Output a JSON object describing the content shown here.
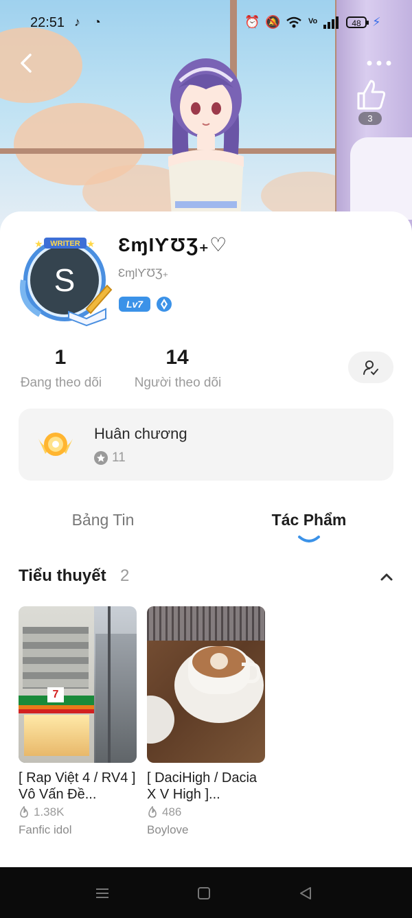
{
  "status_bar": {
    "time": "22:51",
    "battery": "48"
  },
  "header": {
    "like_count": "3"
  },
  "profile": {
    "avatar_letter": "S",
    "avatar_badge": "WRITER",
    "name": "ƐɱƖƳƱƷ₊♡",
    "handle": "ƐɱƖƳƱƷ₊",
    "level": "Lv7"
  },
  "stats": {
    "following_count": "1",
    "following_label": "Đang theo dõi",
    "followers_count": "14",
    "followers_label": "Người theo dõi"
  },
  "medals": {
    "title": "Huân chương",
    "count": "11"
  },
  "tabs": [
    {
      "label": "Bảng Tin",
      "active": false
    },
    {
      "label": "Tác Phẩm",
      "active": true
    }
  ],
  "section": {
    "title": "Tiểu thuyết",
    "count": "2"
  },
  "books": [
    {
      "title": "[ Rap Việt 4 / RV4 ] Vô Vấn Đề...",
      "views": "1.38K",
      "genre": "Fanfic  idol",
      "cover": "store-street-photo"
    },
    {
      "title": "[ DaciHigh / Dacia X V High ]...",
      "views": "486",
      "genre": "Boylove",
      "cover": "coffee-cup-photo"
    }
  ],
  "colors": {
    "accent": "#3b92e8",
    "indicator": "#3b92e8",
    "card_bg": "#f4f4f4"
  }
}
